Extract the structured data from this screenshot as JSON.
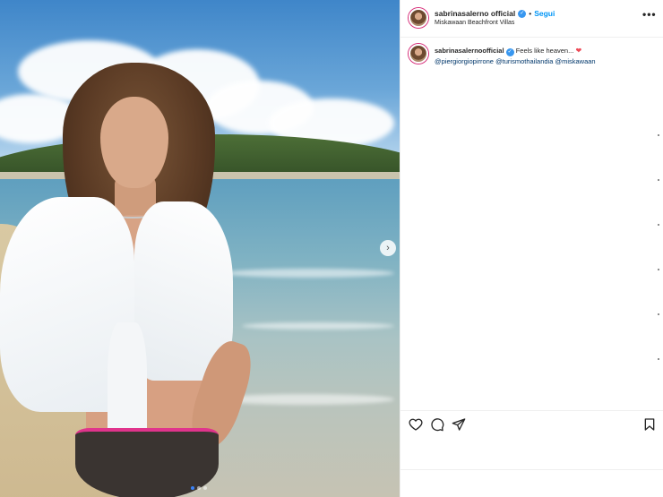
{
  "post": {
    "username": "sabrinasalerno official",
    "verified": true,
    "separator": "•",
    "follow_label": "Segui",
    "location": "Miskawaan Beachfront Villas",
    "more_label": "•••"
  },
  "caption": {
    "username": "sabrinasalernoofficial",
    "text": "Feels like heaven...",
    "mentions_line": "@piergiorgiopirrone @turismothailandia @miskawaan"
  },
  "media": {
    "next_glyph": "›",
    "slide_count": 3,
    "active_slide": 1
  },
  "actions": {
    "like": "heart-icon",
    "comment": "comment-icon",
    "share": "share-icon",
    "save": "bookmark-icon"
  },
  "colors": {
    "follow": "#0095f6",
    "verified": "#3897f0",
    "heart": "#ed4956",
    "mention": "#00376b"
  }
}
